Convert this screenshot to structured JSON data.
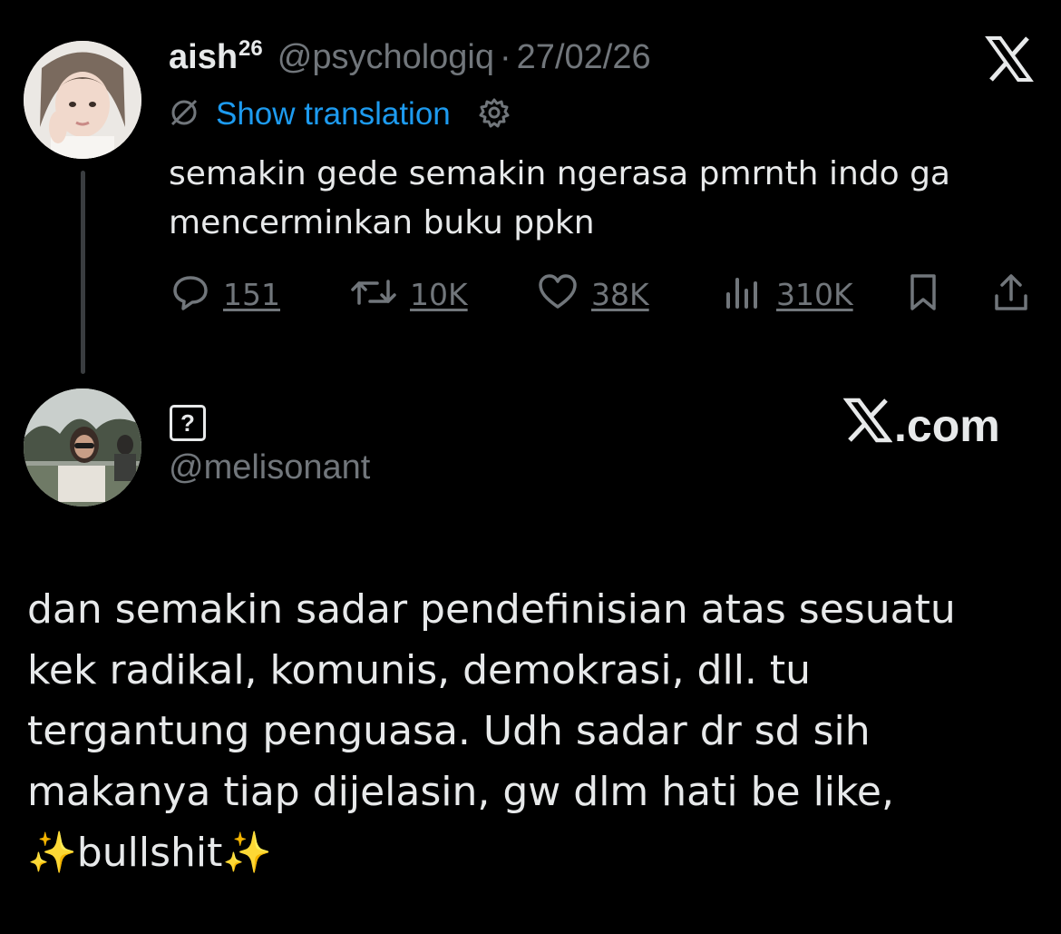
{
  "tweet": {
    "display_name": "aish",
    "name_superscript": "26",
    "handle": "@psychologiq",
    "separator": "·",
    "date": "27/02/26",
    "translation_label": "Show translation",
    "text_lines": [
      "semakin gede semakin ngerasa pmrnth indo ga",
      "mencerminkan buku ppkn"
    ],
    "stats": {
      "replies": "151",
      "reposts": "10K",
      "likes": "38K",
      "views": "310K"
    }
  },
  "quote_author": {
    "unknown_glyph": "?",
    "handle": "@melisonant",
    "site_label": ".com"
  },
  "caption": {
    "lines": [
      "dan semakin sadar pendefinisian atas sesuatu",
      "kek radikal, komunis, demokrasi, dll. tu",
      "tergantung penguasa. Udh sadar dr sd sih",
      "makanya tiap dijelasin, gw dlm hati be like,"
    ],
    "emoji_left": "✨",
    "emphasis": "bullshit",
    "emoji_right": "✨"
  },
  "colors": {
    "background": "#000000",
    "text": "#e7e9ea",
    "muted": "#71767b",
    "link": "#1d9bf0",
    "sparkle": "#f5c518"
  },
  "icons": [
    "x-logo-icon",
    "translate-icon",
    "gear-icon",
    "reply-icon",
    "repost-icon",
    "like-icon",
    "views-icon",
    "bookmark-icon",
    "share-icon"
  ]
}
